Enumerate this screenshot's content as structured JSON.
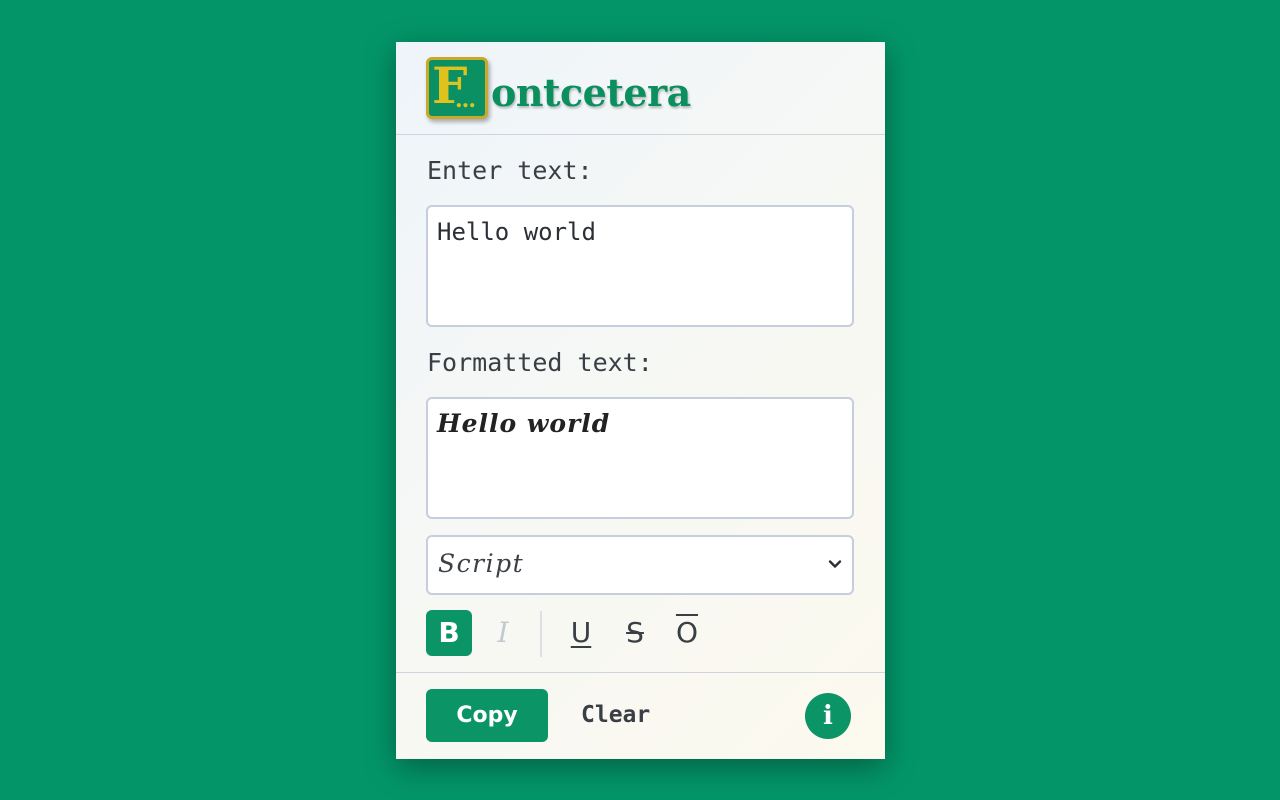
{
  "app": {
    "logo_letter": "F",
    "logo_dots": "...",
    "logo_word": "ontcetera"
  },
  "input": {
    "label": "Enter text:",
    "value": "Hello world"
  },
  "output": {
    "label": "Formatted text:",
    "value": "Hello world"
  },
  "font_select": {
    "selected": "Script",
    "icon": "chevron-down-icon"
  },
  "formatting": {
    "bold": "B",
    "italic": "I",
    "underline": "U",
    "strikethrough": "S",
    "overline": "O",
    "bold_active": true,
    "italic_disabled": true
  },
  "footer": {
    "copy_label": "Copy",
    "clear_label": "Clear",
    "info_glyph": "i",
    "info_icon": "info-icon"
  },
  "colors": {
    "background": "#039568",
    "accent": "#0b9466",
    "logo_gold": "#e0c21f"
  }
}
